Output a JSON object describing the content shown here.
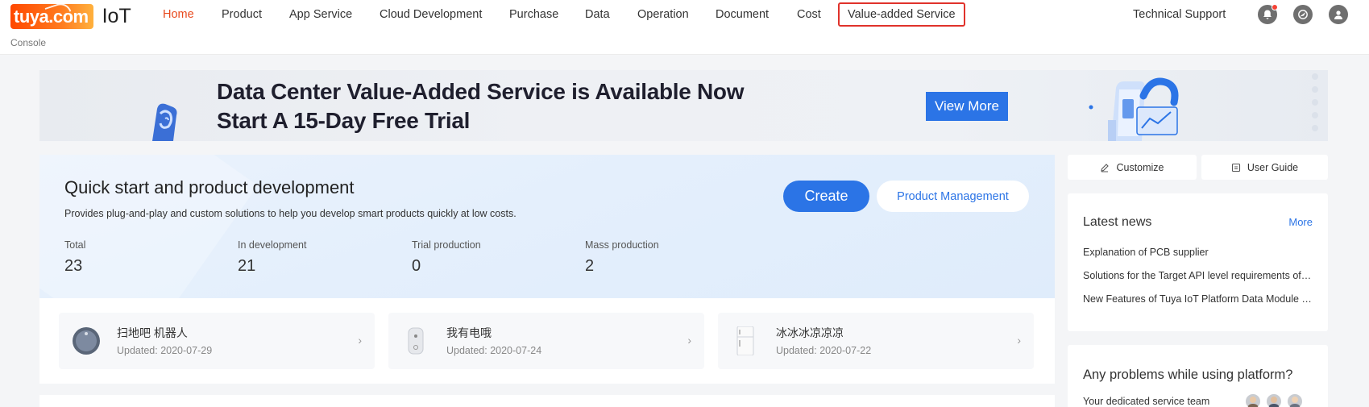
{
  "header": {
    "brand": "tuya.com",
    "product": "IoT",
    "console_label": "Console",
    "nav": [
      {
        "label": "Home",
        "active": true
      },
      {
        "label": "Product"
      },
      {
        "label": "App Service"
      },
      {
        "label": "Cloud Development"
      },
      {
        "label": "Purchase"
      },
      {
        "label": "Data"
      },
      {
        "label": "Operation"
      },
      {
        "label": "Document"
      },
      {
        "label": "Cost"
      },
      {
        "label": "Value-added Service",
        "highlighted": true
      }
    ],
    "support_label": "Technical Support",
    "icons": [
      "bell-icon",
      "compass-icon",
      "user-icon"
    ]
  },
  "banner": {
    "line1": "Data Center Value-Added Service is Available Now",
    "line2": "Start A 15-Day Free Trial",
    "cta": "View More"
  },
  "quick_start": {
    "title": "Quick start and product development",
    "description": "Provides plug-and-play and custom solutions to help you develop smart products quickly at low costs.",
    "create_label": "Create",
    "manage_label": "Product Management",
    "stats": [
      {
        "label": "Total",
        "value": "23"
      },
      {
        "label": "In development",
        "value": "21"
      },
      {
        "label": "Trial production",
        "value": "0"
      },
      {
        "label": "Mass production",
        "value": "2"
      }
    ]
  },
  "products": [
    {
      "name": "扫地吧 机器人",
      "updated": "Updated: 2020-07-29"
    },
    {
      "name": "我有电哦",
      "updated": "Updated: 2020-07-24"
    },
    {
      "name": "冰冰冰凉凉凉",
      "updated": "Updated: 2020-07-22"
    }
  ],
  "sidebar": {
    "customize_label": "Customize",
    "guide_label": "User Guide",
    "news": {
      "title": "Latest news",
      "more": "More",
      "items": [
        "Explanation of PCB supplier",
        "Solutions for the Target API level requirements of Google Play",
        "New Features of Tuya IoT Platform Data Module Release"
      ]
    },
    "help": {
      "title": "Any problems while using platform?",
      "subtitle": "Your dedicated service team"
    }
  },
  "colors": {
    "accent": "#2b74e6",
    "active_nav": "#e8491d",
    "highlight_border": "#e0322b",
    "brand_orange": "#ff5a00"
  }
}
